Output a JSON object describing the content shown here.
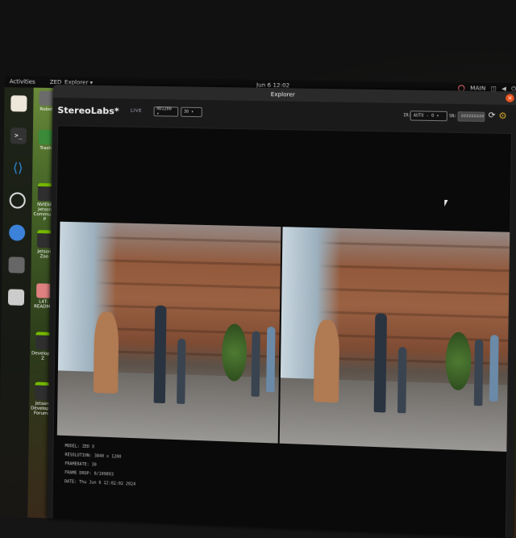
{
  "topbar": {
    "activities": "Activities",
    "app_menu": "ZED_Explorer ▾",
    "clock": "Jun 6 12:02",
    "tray_main": "MAIN"
  },
  "desktop_icons": [
    {
      "label": "Robot",
      "color": "#6b6b6b"
    },
    {
      "label": "Trash",
      "color": "#3a8a3a"
    },
    {
      "label": "NVIDIA Jetson Community P",
      "color": "#2f2f2f"
    },
    {
      "label": "Jetson Zoo",
      "color": "#2f2f2f"
    },
    {
      "label": "L4T-README",
      "color": "#e08080"
    },
    {
      "label": "Developer Z",
      "color": "#2f2f2f"
    },
    {
      "label": "Jetson Developer Forums",
      "color": "#2f2f2f"
    }
  ],
  "window": {
    "title": "Explorer",
    "close_label": "×"
  },
  "toolbar": {
    "brand": "StereoLabs*",
    "live": "LIVE",
    "resolution": "HD1200 ▾",
    "fps": "30 ▾",
    "ir_label": "IR:",
    "ir_value": "AUTO - 0 ▾",
    "sn_label": "SN:",
    "sn_value": "#########",
    "refresh_icon": "refresh-icon",
    "settings_icon": "gear-icon"
  },
  "info": {
    "model": "MODEL: ZED X",
    "resolution": "RESOLUTION: 3840 x 1200",
    "framerate": "FRAMERATE: 30",
    "frame_drop": "FRAME DROP: 0/109893",
    "date": "DATE: Thu Jun 6 12:02:02 2024"
  },
  "colors": {
    "accent": "#e95420",
    "settings": "#c9a02a"
  }
}
